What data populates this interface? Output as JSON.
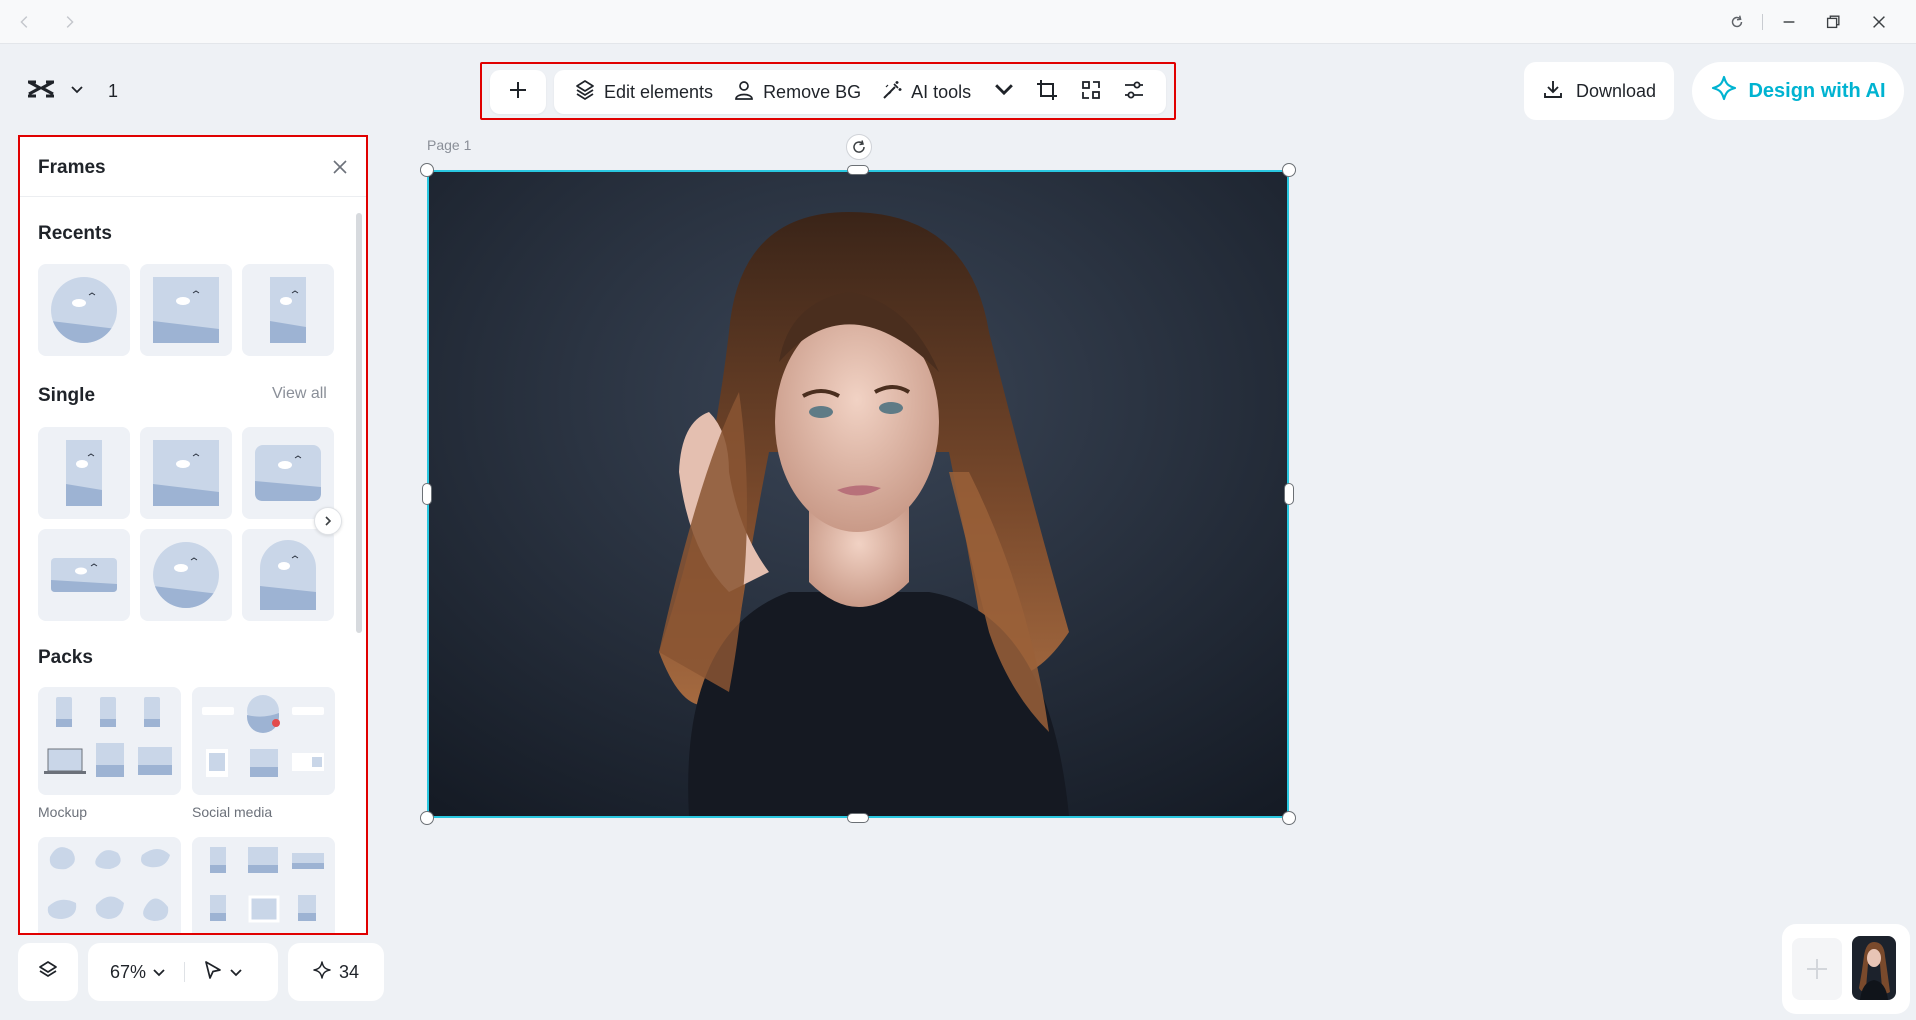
{
  "titlebar": {
    "back_icon": "chevron-left-icon",
    "forward_icon": "chevron-right-icon",
    "refresh_icon": "refresh-icon",
    "minimize_icon": "minimize-icon",
    "restore_icon": "restore-icon",
    "close_icon": "close-icon"
  },
  "header": {
    "page_count": "1"
  },
  "toolbar": {
    "edit_elements": "Edit elements",
    "remove_bg": "Remove BG",
    "ai_tools": "AI tools"
  },
  "actions": {
    "download": "Download",
    "design_with_ai": "Design with AI"
  },
  "colors": {
    "accent": "#00b3d1",
    "highlight_border": "#e00000",
    "selection": "#29c7e0"
  },
  "frames_panel": {
    "title": "Frames",
    "recents_title": "Recents",
    "single_title": "Single",
    "view_all": "View all",
    "packs_title": "Packs",
    "packs": [
      {
        "label": "Mockup"
      },
      {
        "label": "Social media"
      }
    ]
  },
  "canvas": {
    "page_label": "Page 1"
  },
  "bottom_bar": {
    "zoom": "67%",
    "credits": "34"
  }
}
